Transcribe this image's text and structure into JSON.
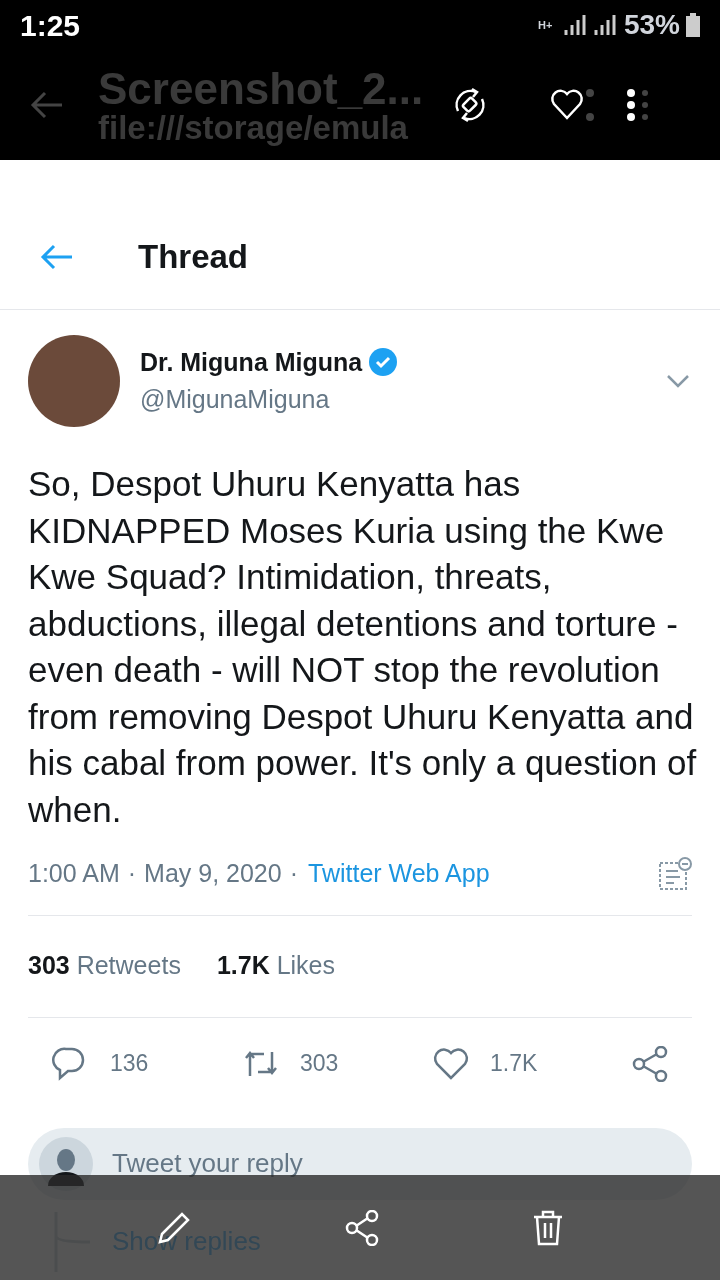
{
  "status_bar": {
    "time": "1:25",
    "network": "H+",
    "battery": "53%"
  },
  "viewer_bar": {
    "title": "Screenshot_2...",
    "path": "file:///storage/emula"
  },
  "header": {
    "title": "Thread"
  },
  "tweet": {
    "name": "Dr. Miguna Miguna",
    "verified": true,
    "handle": "@MigunaMiguna",
    "text": "So, Despot Uhuru Kenyatta has KIDNAPPED Moses Kuria using the Kwe Kwe Squad? Intimidation, threats, abductions, illegal detentions and torture - even death - will NOT stop the revolution from removing Despot Uhuru Kenyatta and his cabal from power. It's only a question of when.",
    "time": "1:00 AM",
    "separator_1": "·",
    "date": "May 9, 2020",
    "separator_2": "·",
    "source": "Twitter Web App",
    "stats": [
      {
        "count": "303",
        "label": "Retweets"
      },
      {
        "count": "1.7K",
        "label": "Likes"
      }
    ],
    "actions": [
      {
        "kind": "reply",
        "count": "136"
      },
      {
        "kind": "retweet",
        "count": "303"
      },
      {
        "kind": "like",
        "count": "1.7K"
      },
      {
        "kind": "share"
      }
    ]
  },
  "reply": {
    "placeholder": "Tweet your reply"
  },
  "show_replies": "Show replies"
}
